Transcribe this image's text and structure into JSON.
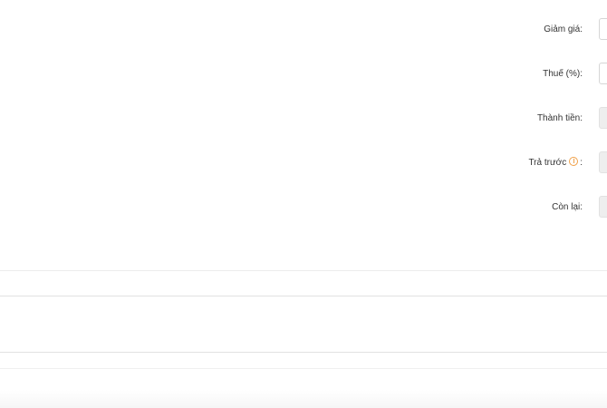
{
  "summary": {
    "discount": {
      "label": "Giảm giá:"
    },
    "tax": {
      "label": "Thuế (%):"
    },
    "total": {
      "label": "Thành tiền:"
    },
    "prepaid": {
      "label": "Trả trước",
      "suffix": ":",
      "icon": "info-icon"
    },
    "remaining": {
      "label": "Còn lại:"
    }
  },
  "colors": {
    "info_icon": "#f0a14a",
    "divider": "#e6e6e6",
    "readonly_field": "#eeeeee",
    "footer_band": "#f7f7f7"
  }
}
